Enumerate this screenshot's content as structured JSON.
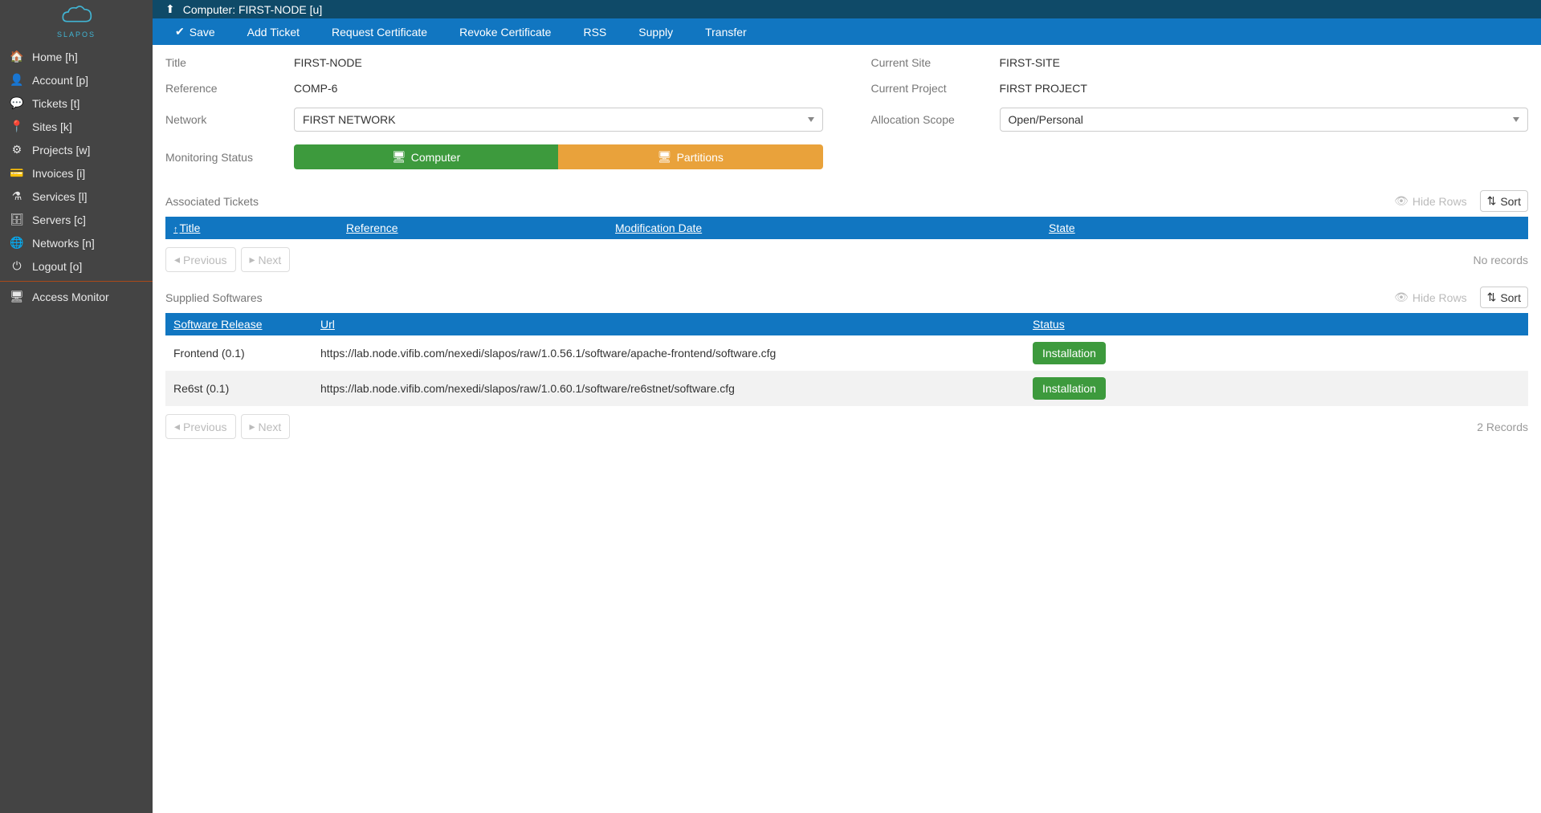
{
  "logo_text": "SLAPOS",
  "sidebar": {
    "items": [
      {
        "icon": "🏠",
        "label": "Home [h]"
      },
      {
        "icon": "👤",
        "label": "Account [p]"
      },
      {
        "icon": "💬",
        "label": "Tickets [t]"
      },
      {
        "icon": "📍",
        "label": "Sites [k]"
      },
      {
        "icon": "⚙",
        "label": "Projects [w]"
      },
      {
        "icon": "💳",
        "label": "Invoices [i]"
      },
      {
        "icon": "⚗",
        "label": "Services [l]"
      },
      {
        "icon": "🗄",
        "label": "Servers [c]"
      },
      {
        "icon": "🌐",
        "label": "Networks [n]"
      },
      {
        "icon": "⏻",
        "label": "Logout [o]"
      }
    ],
    "monitor": {
      "icon": "🖥",
      "label": "Access Monitor"
    }
  },
  "titlebar": {
    "prefix": "Computer:",
    "title": "FIRST-NODE [u]"
  },
  "actions": [
    {
      "icon": "✔",
      "label": "Save"
    },
    {
      "icon": "",
      "label": "Add Ticket"
    },
    {
      "icon": "",
      "label": "Request Certificate"
    },
    {
      "icon": "",
      "label": "Revoke Certificate"
    },
    {
      "icon": "",
      "label": "RSS"
    },
    {
      "icon": "",
      "label": "Supply"
    },
    {
      "icon": "",
      "label": "Transfer"
    }
  ],
  "form": {
    "title_label": "Title",
    "title_value": "FIRST-NODE",
    "reference_label": "Reference",
    "reference_value": "COMP-6",
    "network_label": "Network",
    "network_value": "FIRST NETWORK",
    "monitoring_label": "Monitoring Status",
    "monitoring_computer": "Computer",
    "monitoring_partitions": "Partitions",
    "site_label": "Current Site",
    "site_value": "FIRST-SITE",
    "project_label": "Current Project",
    "project_value": "FIRST PROJECT",
    "scope_label": "Allocation Scope",
    "scope_value": "Open/Personal"
  },
  "tickets": {
    "title": "Associated Tickets",
    "hide_rows": "Hide Rows",
    "sort": "Sort",
    "cols": {
      "title": "Title",
      "reference": "Reference",
      "mod": "Modification Date",
      "state": "State"
    },
    "no_records": "No records",
    "prev": "Previous",
    "next": "Next"
  },
  "soft": {
    "title": "Supplied Softwares",
    "hide_rows": "Hide Rows",
    "sort": "Sort",
    "cols": {
      "release": "Software Release",
      "url": "Url",
      "status": "Status"
    },
    "rows": [
      {
        "release": "Frontend (0.1)",
        "url": "https://lab.node.vifib.com/nexedi/slapos/raw/1.0.56.1/software/apache-frontend/software.cfg",
        "status": "Installation"
      },
      {
        "release": "Re6st (0.1)",
        "url": "https://lab.node.vifib.com/nexedi/slapos/raw/1.0.60.1/software/re6stnet/software.cfg",
        "status": "Installation"
      }
    ],
    "records": "2 Records",
    "prev": "Previous",
    "next": "Next"
  },
  "chart_data": null
}
